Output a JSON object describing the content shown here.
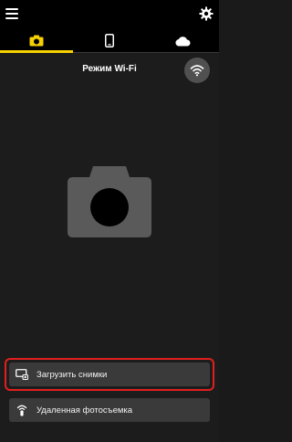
{
  "header": {
    "menu_icon": "hamburger-menu-icon",
    "settings_icon": "gear-icon"
  },
  "tabs": [
    {
      "icon": "camera-icon",
      "active": true
    },
    {
      "icon": "phone-icon",
      "active": false
    },
    {
      "icon": "cloud-icon",
      "active": false
    }
  ],
  "main": {
    "mode_title": "Режим Wi-Fi",
    "wifi_icon": "wifi-icon",
    "camera_illustration": "camera-icon"
  },
  "actions": {
    "upload_label": "Загрузить снимки",
    "remote_label": "Удаленная фотосъемка"
  },
  "colors": {
    "accent": "#f7d100",
    "highlight": "#e0201e",
    "background": "#1c1c1c",
    "button": "#3a3a3a"
  }
}
